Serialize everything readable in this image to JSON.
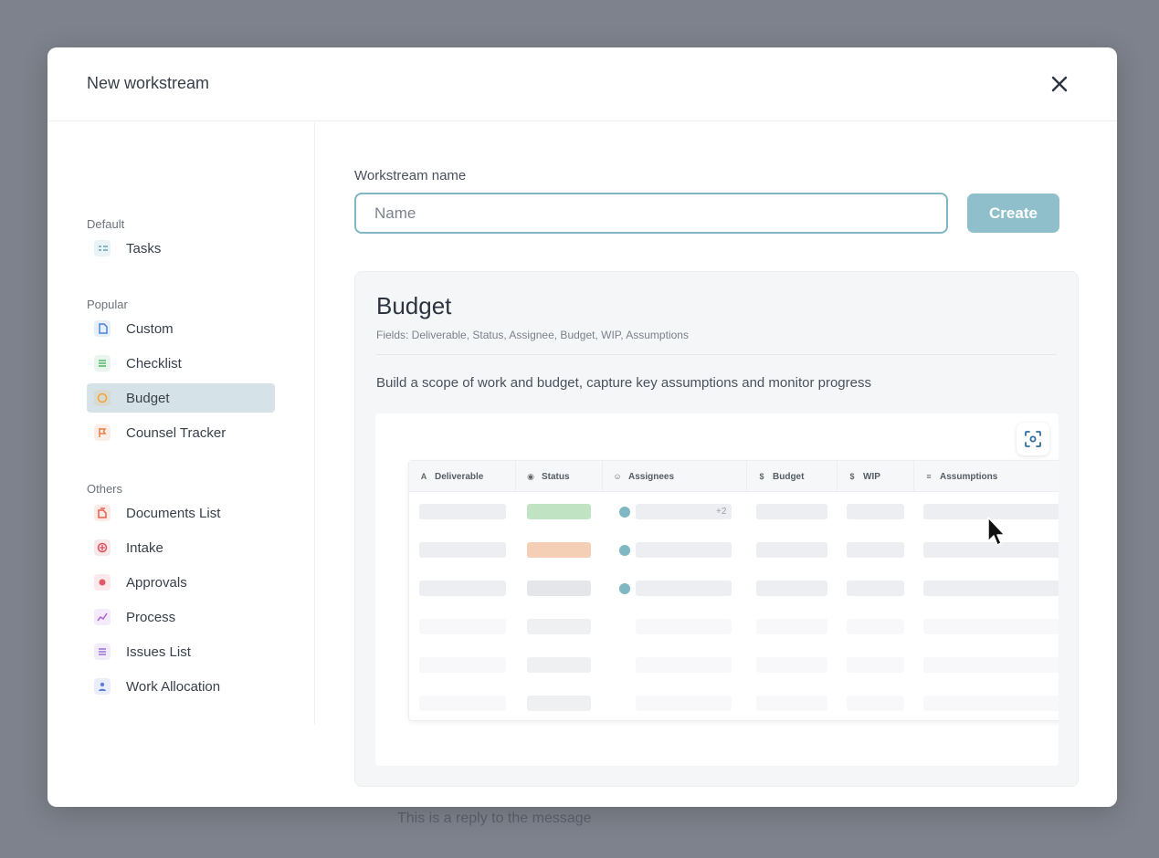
{
  "modal": {
    "title": "New workstream",
    "close_icon": "close-icon"
  },
  "sidebar": {
    "groups": [
      {
        "label": "Default",
        "items": [
          {
            "label": "Tasks",
            "icon": "tasks-icon",
            "color": "#5fa3b3",
            "active": false
          }
        ]
      },
      {
        "label": "Popular",
        "items": [
          {
            "label": "Custom",
            "icon": "document-icon",
            "color": "#4a84d8",
            "active": false
          },
          {
            "label": "Checklist",
            "icon": "checklist-icon",
            "color": "#4fb86a",
            "active": false
          },
          {
            "label": "Budget",
            "icon": "budget-icon",
            "color": "#f0a63a",
            "active": true
          },
          {
            "label": "Counsel Tracker",
            "icon": "flag-icon",
            "color": "#e8804a",
            "active": false
          }
        ]
      },
      {
        "label": "Others",
        "items": [
          {
            "label": "Documents List",
            "icon": "documents-icon",
            "color": "#e8604a",
            "active": false
          },
          {
            "label": "Intake",
            "icon": "intake-icon",
            "color": "#e0505e",
            "active": false
          },
          {
            "label": "Approvals",
            "icon": "approvals-icon",
            "color": "#e05a6a",
            "active": false
          },
          {
            "label": "Process",
            "icon": "process-icon",
            "color": "#b060d0",
            "active": false
          },
          {
            "label": "Issues List",
            "icon": "issues-icon",
            "color": "#9a70d8",
            "active": false
          },
          {
            "label": "Work Allocation",
            "icon": "people-icon",
            "color": "#5a80d8",
            "active": false
          }
        ]
      }
    ]
  },
  "form": {
    "name_label": "Workstream name",
    "name_placeholder": "Name",
    "name_value": "",
    "create_label": "Create"
  },
  "preview": {
    "title": "Budget",
    "fields": "Fields: Deliverable, Status, Assignee, Budget, WIP, Assumptions",
    "description": "Build a scope of work and budget, capture key assumptions and monitor progress",
    "table_columns": [
      {
        "label": "Deliverable",
        "icon": "A"
      },
      {
        "label": "Status",
        "icon": "◉"
      },
      {
        "label": "Assignees",
        "icon": "☺"
      },
      {
        "label": "Budget",
        "icon": "$"
      },
      {
        "label": "WIP",
        "icon": "$"
      },
      {
        "label": "Assumptions",
        "icon": "≡"
      }
    ],
    "plus_badge": "+2"
  },
  "background": {
    "behind_text": "This is a reply to the message"
  }
}
